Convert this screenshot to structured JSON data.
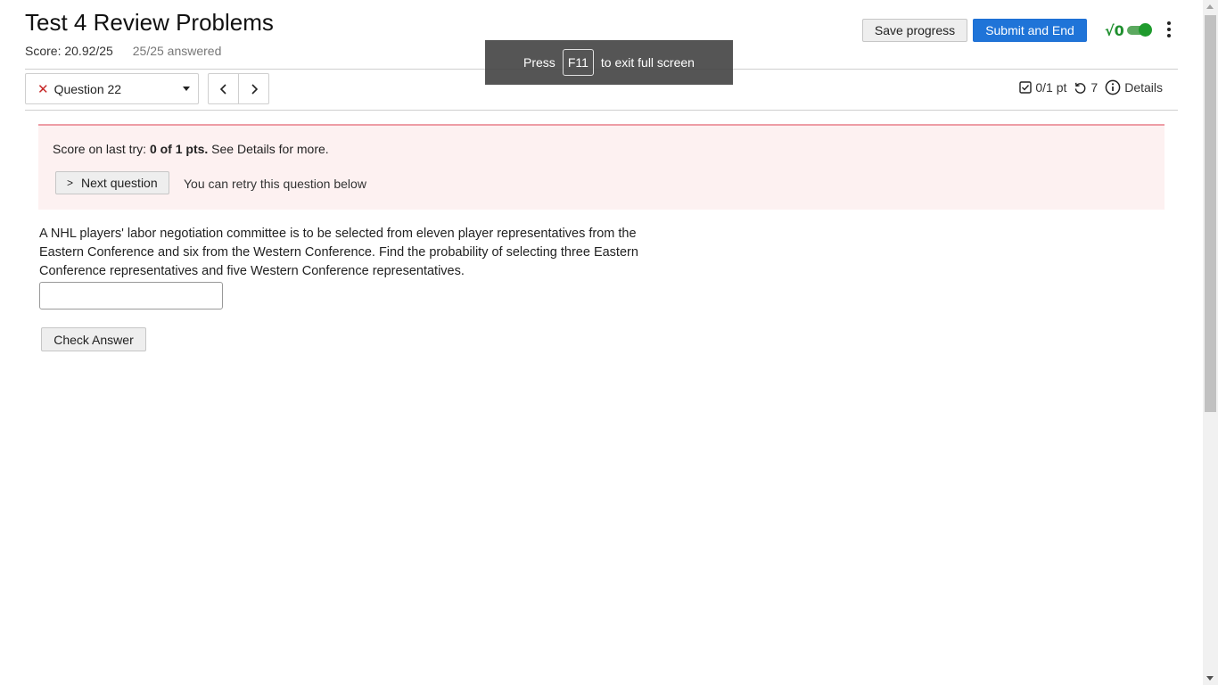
{
  "header": {
    "title": "Test 4 Review Problems",
    "score": "Score: 20.92/25",
    "answered": "25/25 answered",
    "save_label": "Save progress",
    "submit_label": "Submit and End",
    "math_toggle_glyph": "√0"
  },
  "toast": {
    "press": "Press",
    "key": "F11",
    "rest": "to exit full screen"
  },
  "nav": {
    "question_label": "Question 22",
    "points": "0/1 pt",
    "attempts": "7",
    "details_label": "Details"
  },
  "feedback": {
    "score_prefix": "Score on last try: ",
    "score_bold": "0 of 1 pts.",
    "score_suffix": " See Details for more.",
    "next_label": "Next question",
    "retry_text": "You can retry this question below"
  },
  "question": {
    "text": "A NHL players' labor negotiation committee is to be selected from eleven player representatives from the Eastern Conference and six from the Western Conference. Find the probability of selecting three Eastern Conference representatives and five Western Conference representatives.",
    "answer_value": "",
    "check_label": "Check Answer"
  },
  "colors": {
    "primary": "#1f74d8",
    "error": "#c62828",
    "feedback_bg": "#fdf1f1",
    "feedback_border": "#ee9da5",
    "toggle_green": "#1f9b2d"
  }
}
